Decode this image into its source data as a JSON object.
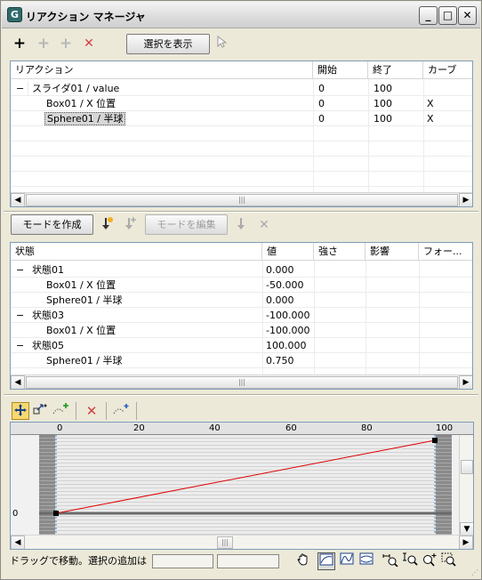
{
  "window": {
    "title": "リアクション マネージャ",
    "app_icon": "G",
    "min_symbol": "_",
    "max_symbol": "□",
    "close_symbol": "✕"
  },
  "toolbar": {
    "add_icon": "+",
    "add_disabled_1_icon": "+",
    "add_disabled_2_icon": "+",
    "delete_icon": "✕",
    "show_selection_label": "選択を表示",
    "pick_icon": "cursor-pick-icon"
  },
  "reactions_table": {
    "headers": [
      "リアクション",
      "開始",
      "終了",
      "カーブ"
    ],
    "rows": [
      {
        "toggle": "−",
        "name": "スライダ01 / value",
        "start": "0",
        "end": "100",
        "curve": ""
      },
      {
        "toggle": "",
        "name": "Box01 / X 位置",
        "start": "0",
        "end": "100",
        "curve": "X"
      },
      {
        "toggle": "",
        "name": "Sphere01 / 半球",
        "start": "0",
        "end": "100",
        "curve": "X"
      }
    ],
    "scroll_left": "◀",
    "scroll_right": "▶",
    "thumb_grip": "|||"
  },
  "mode_toolbar": {
    "create_mode_label": "モードを作成",
    "edit_mode_label": "モードを編集"
  },
  "states_table": {
    "headers": [
      "状態",
      "値",
      "強さ",
      "影響",
      "フォー..."
    ],
    "rows": [
      {
        "toggle": "−",
        "name": "状態01",
        "value": "0.000"
      },
      {
        "toggle": "",
        "name": "Box01 / X 位置",
        "value": "-50.000"
      },
      {
        "toggle": "",
        "name": "Sphere01 / 半球",
        "value": "0.000"
      },
      {
        "toggle": "−",
        "name": "状態03",
        "value": "-100.000"
      },
      {
        "toggle": "",
        "name": "Box01 / X 位置",
        "value": "-100.000"
      },
      {
        "toggle": "−",
        "name": "状態05",
        "value": "100.000"
      },
      {
        "toggle": "",
        "name": "Sphere01 / 半球",
        "value": "0.750"
      }
    ],
    "scroll_left": "◀",
    "scroll_right": "▶",
    "thumb_grip": "|||"
  },
  "curve_editor": {
    "ruler_labels": [
      "0",
      "20",
      "40",
      "60",
      "80",
      "100"
    ],
    "y_label": "0",
    "curve": {
      "start": [
        0,
        0
      ],
      "end": [
        100,
        1
      ]
    },
    "curve_color": "#e00000",
    "scroll_left": "◀",
    "scroll_right": "▶",
    "scroll_down": "▼",
    "thumb_grip": "|||"
  },
  "statusbar": {
    "message": "ドラッグで移動。選択の追加は"
  }
}
